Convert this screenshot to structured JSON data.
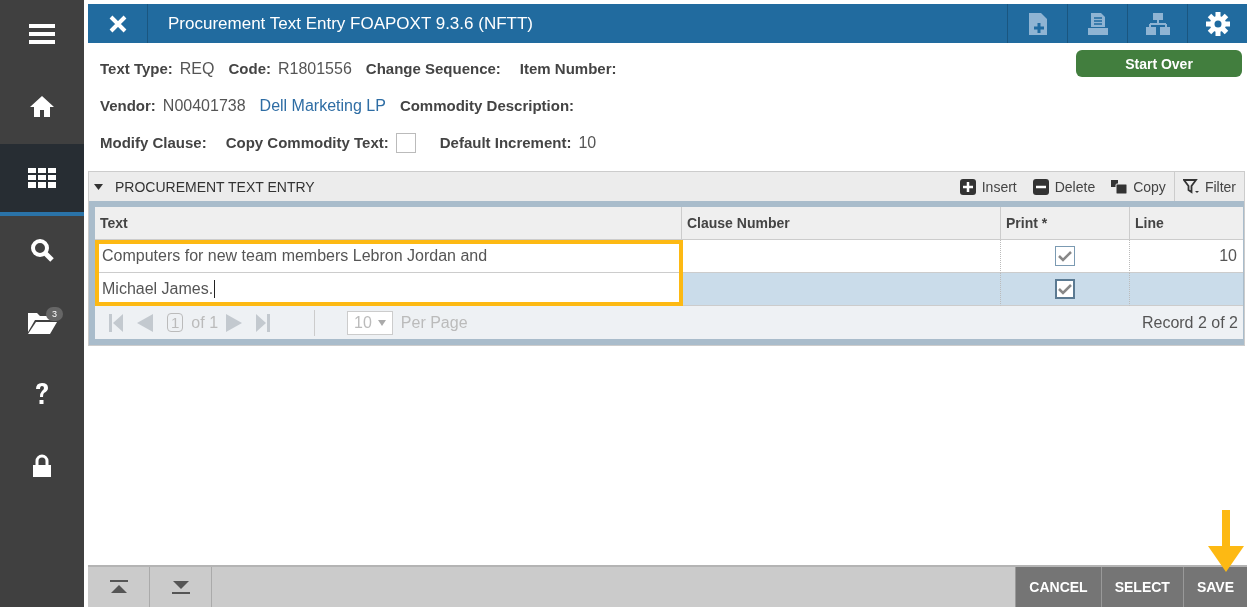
{
  "sidebar": {
    "items": [
      {
        "kind": "menu",
        "selected": false
      },
      {
        "kind": "home",
        "selected": false
      },
      {
        "kind": "apps",
        "selected": true
      },
      {
        "kind": "search",
        "selected": false
      },
      {
        "kind": "folder",
        "selected": false,
        "badge": "3"
      },
      {
        "kind": "help",
        "selected": false
      },
      {
        "kind": "lock",
        "selected": false
      }
    ]
  },
  "header": {
    "title": "Procurement Text Entry FOAPOXT 9.3.6 (NFTT)",
    "actions": [
      {
        "kind": "add-doc"
      },
      {
        "kind": "doc"
      },
      {
        "kind": "tree"
      },
      {
        "kind": "settings"
      }
    ]
  },
  "start_over": "Start Over",
  "key_block": [
    [
      {
        "kind": "label",
        "text": "Text Type:"
      },
      {
        "kind": "value",
        "text": "REQ"
      },
      {
        "kind": "label",
        "text": "Code:"
      },
      {
        "kind": "value",
        "text": "R1801556"
      },
      {
        "kind": "label",
        "text": "Change Sequence:"
      },
      {
        "kind": "label",
        "text": "Item Number:"
      }
    ],
    [
      {
        "kind": "label",
        "text": "Vendor:"
      },
      {
        "kind": "value",
        "text": "N00401738"
      },
      {
        "kind": "link",
        "text": "Dell Marketing LP"
      },
      {
        "kind": "label",
        "text": "Commodity Description:"
      }
    ],
    [
      {
        "kind": "label",
        "text": "Modify Clause:"
      },
      {
        "kind": "label",
        "text": "Copy Commodity Text:"
      },
      {
        "kind": "checkbox",
        "checked": false
      },
      {
        "kind": "label",
        "text": "Default Increment:"
      },
      {
        "kind": "value",
        "text": "10"
      }
    ]
  ],
  "section": {
    "title": "PROCUREMENT TEXT ENTRY",
    "tools": [
      {
        "kind": "insert",
        "label": "Insert"
      },
      {
        "kind": "delete",
        "label": "Delete"
      },
      {
        "kind": "copy",
        "label": "Copy"
      },
      {
        "kind": "filter",
        "label": "Filter"
      }
    ]
  },
  "table": {
    "columns": [
      "Text",
      "Clause Number",
      "Print *",
      "Line"
    ],
    "rows": [
      {
        "text": "Computers for new team members Lebron Jordan and",
        "print": true,
        "line": "10",
        "selected": false
      },
      {
        "text": "Michael James.",
        "print": true,
        "selected": true
      }
    ]
  },
  "pager": {
    "page": "1",
    "of": "of 1",
    "per_page": "10",
    "per_page_label": "Per Page",
    "record": "Record 2 of 2"
  },
  "footer": {
    "buttons": [
      "CANCEL",
      "SELECT",
      "SAVE"
    ]
  }
}
